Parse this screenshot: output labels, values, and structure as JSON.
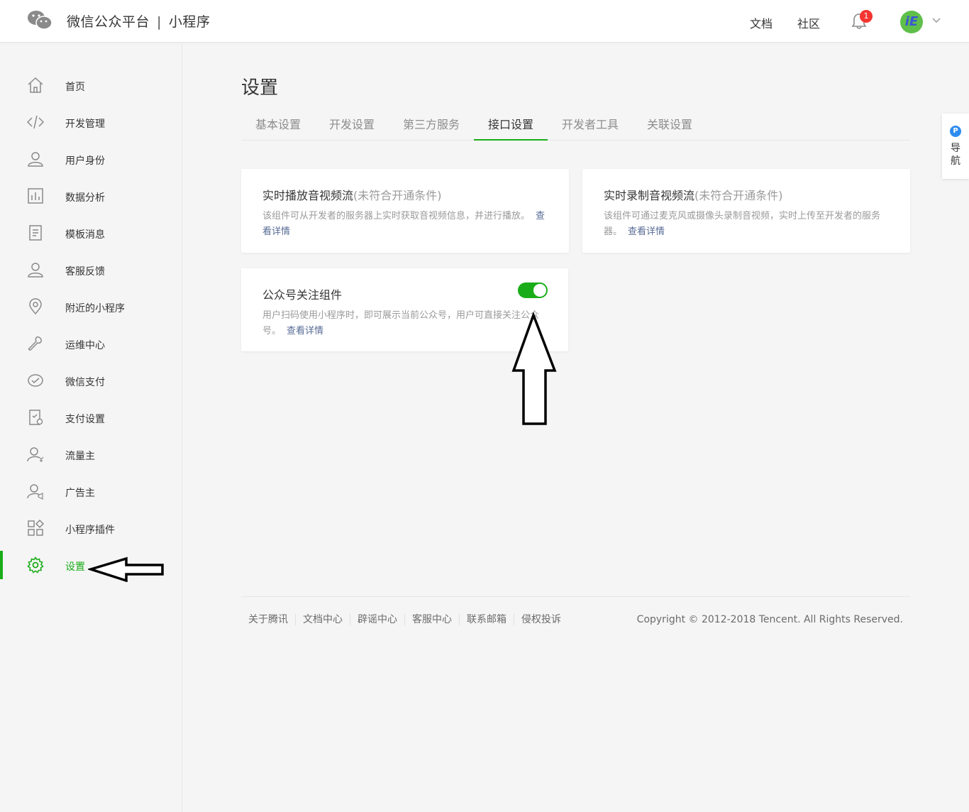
{
  "header": {
    "brand_name": "微信公众平台",
    "brand_sep": "|",
    "brand_product": "小程序",
    "links": [
      "文档",
      "社区"
    ],
    "notification_count": "1",
    "avatar_text": "iE",
    "accent": "#1aad19"
  },
  "sidebar": {
    "items": [
      {
        "label": "首页",
        "icon": "home-icon"
      },
      {
        "label": "开发管理",
        "icon": "code-icon"
      },
      {
        "label": "用户身份",
        "icon": "user-icon"
      },
      {
        "label": "数据分析",
        "icon": "chart-icon"
      },
      {
        "label": "模板消息",
        "icon": "document-icon"
      },
      {
        "label": "客服反馈",
        "icon": "service-icon"
      },
      {
        "label": "附近的小程序",
        "icon": "location-icon"
      },
      {
        "label": "运维中心",
        "icon": "wrench-icon"
      },
      {
        "label": "微信支付",
        "icon": "pay-icon"
      },
      {
        "label": "支付设置",
        "icon": "pay-settings-icon"
      },
      {
        "label": "流量主",
        "icon": "traffic-owner-icon"
      },
      {
        "label": "广告主",
        "icon": "advertiser-icon"
      },
      {
        "label": "小程序插件",
        "icon": "plugin-icon"
      },
      {
        "label": "设置",
        "icon": "gear-icon",
        "active": true
      }
    ]
  },
  "main": {
    "title": "设置",
    "tabs": [
      "基本设置",
      "开发设置",
      "第三方服务",
      "接口设置",
      "开发者工具",
      "关联设置"
    ],
    "active_tab": "接口设置",
    "cards": [
      {
        "title": "实时播放音视频流",
        "status": "(未符合开通条件)",
        "desc": "该组件可从开发者的服务器上实时获取音视频信息，并进行播放。",
        "link": "查看详情"
      },
      {
        "title": "实时录制音视频流",
        "status": "(未符合开通条件)",
        "desc": "该组件可通过麦克风或摄像头录制音视频，实时上传至开发者的服务器。",
        "link": "查看详情"
      },
      {
        "title": "公众号关注组件",
        "desc": "用户扫码使用小程序时，即可展示当前公众号，用户可直接关注公众号。",
        "link": "查看详情",
        "enabled": true
      }
    ]
  },
  "footer": {
    "links": [
      "关于腾讯",
      "文档中心",
      "辟谣中心",
      "客服中心",
      "联系邮箱",
      "侵权投诉"
    ],
    "copyright": "Copyright © 2012-2018 Tencent. All Rights Reserved."
  },
  "float_nav": {
    "badge": "P",
    "label_1": "导",
    "label_2": "航"
  }
}
